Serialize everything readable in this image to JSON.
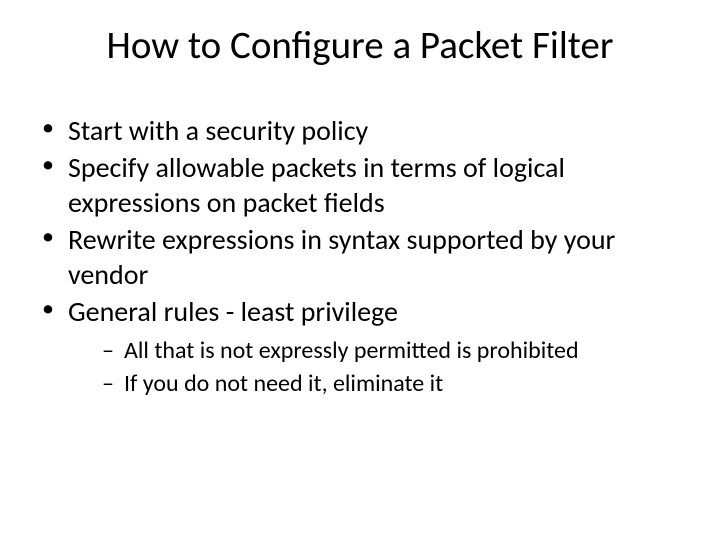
{
  "title": "How to Configure a Packet Filter",
  "bullets": [
    "Start with a security policy",
    "Specify allowable packets in terms of logical expressions on packet fields",
    "Rewrite expressions in syntax supported by your vendor",
    "General rules - least privilege"
  ],
  "subbullets": [
    "All that is not expressly permitted is prohibited",
    "If you do not need it, eliminate it"
  ]
}
